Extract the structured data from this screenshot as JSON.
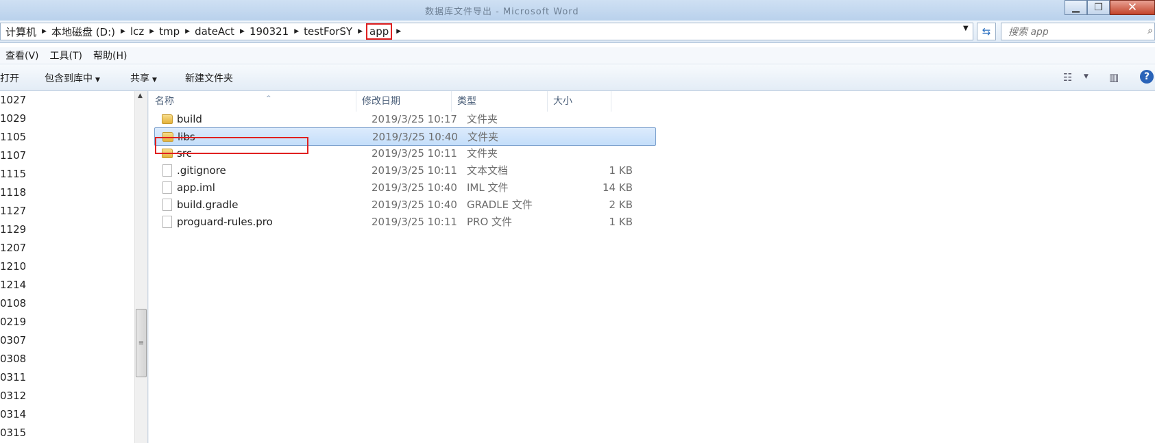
{
  "window": {
    "title": "数据库文件导出 - Microsoft Word",
    "min_glyph": "▁",
    "max_glyph": "❐",
    "close_glyph": "✕"
  },
  "address": {
    "crumbs": [
      "计算机",
      "本地磁盘 (D:)",
      "lcz",
      "tmp",
      "dateAct",
      "190321",
      "testForSY",
      "app"
    ],
    "search_placeholder": "搜索 app"
  },
  "menu": [
    "查看(V)",
    "工具(T)",
    "帮助(H)"
  ],
  "toolbar": {
    "open": "打开",
    "include_library": "包含到库中",
    "share": "共享",
    "new_folder": "新建文件夹"
  },
  "nav_items": [
    "1027",
    "1029",
    "1105",
    "1107",
    "1115",
    "1118",
    "1127",
    "1129",
    "1207",
    "1210",
    "1214",
    "0108",
    "0219",
    "0307",
    "0308",
    "0311",
    "0312",
    "0314",
    "0315"
  ],
  "columns": {
    "name": "名称",
    "date": "修改日期",
    "type": "类型",
    "size": "大小"
  },
  "files": [
    {
      "name": "build",
      "date": "2019/3/25 10:17",
      "type": "文件夹",
      "size": "",
      "icon": "folder-icon"
    },
    {
      "name": "libs",
      "date": "2019/3/25 10:40",
      "type": "文件夹",
      "size": "",
      "icon": "folder-icon",
      "selected": true
    },
    {
      "name": "src",
      "date": "2019/3/25 10:11",
      "type": "文件夹",
      "size": "",
      "icon": "folder-icon"
    },
    {
      "name": ".gitignore",
      "date": "2019/3/25 10:11",
      "type": "文本文档",
      "size": "1 KB",
      "icon": "text-file-icon"
    },
    {
      "name": "app.iml",
      "date": "2019/3/25 10:40",
      "type": "IML 文件",
      "size": "14 KB",
      "icon": "file-icon"
    },
    {
      "name": "build.gradle",
      "date": "2019/3/25 10:40",
      "type": "GRADLE 文件",
      "size": "2 KB",
      "icon": "file-icon"
    },
    {
      "name": "proguard-rules.pro",
      "date": "2019/3/25 10:11",
      "type": "PRO 文件",
      "size": "1 KB",
      "icon": "file-icon"
    }
  ],
  "colors": {
    "selection": "#cfe4fb",
    "highlight_box": "#e02020"
  }
}
